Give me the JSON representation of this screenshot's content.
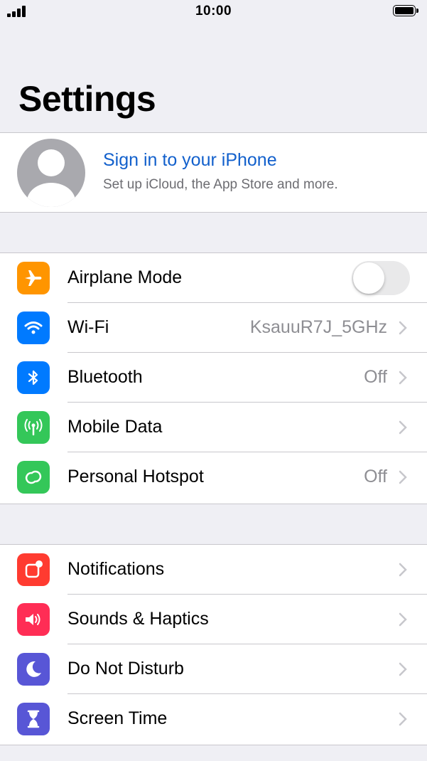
{
  "status_bar": {
    "time": "10:00"
  },
  "title": "Settings",
  "profile": {
    "title": "Sign in to your iPhone",
    "subtitle": "Set up iCloud, the App Store and more."
  },
  "groups": [
    {
      "items": [
        {
          "label": "Airplane Mode",
          "value": "",
          "icon": "airplane-icon",
          "color": "#ff9500",
          "toggle": true,
          "toggle_on": false
        },
        {
          "label": "Wi-Fi",
          "value": "KsauuR7J_5GHz",
          "icon": "wifi-icon",
          "color": "#007aff"
        },
        {
          "label": "Bluetooth",
          "value": "Off",
          "icon": "bluetooth-icon",
          "color": "#007aff"
        },
        {
          "label": "Mobile Data",
          "value": "",
          "icon": "antenna-icon",
          "color": "#34c759"
        },
        {
          "label": "Personal Hotspot",
          "value": "Off",
          "icon": "hotspot-icon",
          "color": "#34c759"
        }
      ]
    },
    {
      "items": [
        {
          "label": "Notifications",
          "value": "",
          "icon": "notifications-icon",
          "color": "#ff3b30"
        },
        {
          "label": "Sounds & Haptics",
          "value": "",
          "icon": "speaker-icon",
          "color": "#ff2d55"
        },
        {
          "label": "Do Not Disturb",
          "value": "",
          "icon": "moon-icon",
          "color": "#5856d6"
        },
        {
          "label": "Screen Time",
          "value": "",
          "icon": "hourglass-icon",
          "color": "#5856d6"
        }
      ]
    }
  ]
}
